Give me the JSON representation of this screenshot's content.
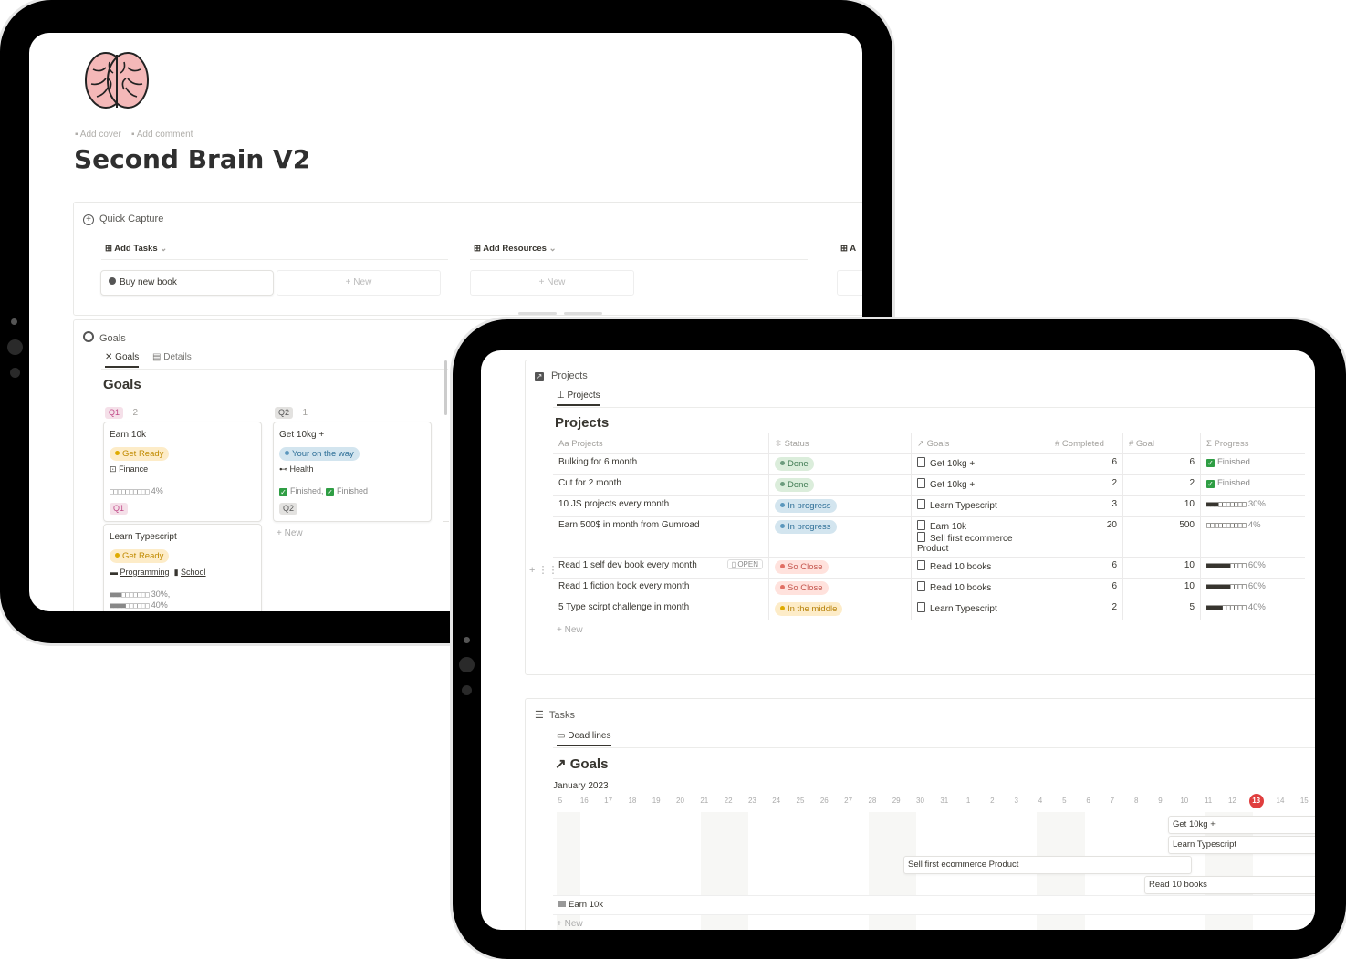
{
  "back": {
    "add_cover": "Add cover",
    "add_comment": "Add comment",
    "page_title": "Second Brain V2",
    "quick_capture": {
      "title": "Quick Capture",
      "add_tasks": "Add Tasks",
      "add_resources": "Add Resources",
      "clipped": "A",
      "task_item": "Buy new book",
      "new_label": "New"
    },
    "goals": {
      "section_title": "Goals",
      "tab_goals": "Goals",
      "tab_details": "Details",
      "heading": "Goals",
      "q1": {
        "label": "Q1",
        "count": "2"
      },
      "q2": {
        "label": "Q2",
        "count": "1"
      },
      "cards": {
        "earn": {
          "title": "Earn 10k",
          "status": "Get Ready",
          "tag": "Finance",
          "progress": "4%",
          "q": "Q1",
          "progress_value": 0.04
        },
        "typescript": {
          "title": "Learn Typescript",
          "status": "Get Ready",
          "tag1": "Programming",
          "tag2": "School",
          "p1": "30%",
          "p2": "40%",
          "p1_value": 0.3,
          "p2_value": 0.4
        },
        "get10kg": {
          "title": "Get 10kg +",
          "status": "Your on the way",
          "tag": "Health",
          "done1": "Finished",
          "done2": "Finished",
          "q": "Q2"
        }
      },
      "new_label": "New"
    }
  },
  "front": {
    "projects": {
      "section_title": "Projects",
      "tab": "Projects",
      "heading": "Projects",
      "columns": {
        "name": "Aa Projects",
        "status": "Status",
        "goals": "Goals",
        "completed": "# Completed",
        "goal": "# Goal",
        "progress": "Σ Progress"
      },
      "open_label": "OPEN",
      "rows": [
        {
          "name": "Bulking for 6 month",
          "status": "Done",
          "goals": [
            "Get 10kg +"
          ],
          "completed": "6",
          "goal": "6",
          "progress": "Finished",
          "progress_value": 1.0
        },
        {
          "name": "Cut for 2 month",
          "status": "Done",
          "goals": [
            "Get 10kg +"
          ],
          "completed": "2",
          "goal": "2",
          "progress": "Finished",
          "progress_value": 1.0
        },
        {
          "name": "10 JS projects every month",
          "status": "In progress",
          "goals": [
            "Learn Typescript"
          ],
          "completed": "3",
          "goal": "10",
          "progress": "30%",
          "progress_value": 0.3
        },
        {
          "name": "Earn 500$ in month from Gumroad",
          "status": "In progress",
          "goals": [
            "Earn 10k",
            "Sell first ecommerce Product"
          ],
          "completed": "20",
          "goal": "500",
          "progress": "4%",
          "progress_value": 0.04
        },
        {
          "name": "Read 1 self dev book every month",
          "status": "So Close",
          "goals": [
            "Read 10 books"
          ],
          "completed": "6",
          "goal": "10",
          "progress": "60%",
          "progress_value": 0.6
        },
        {
          "name": "Read 1 fiction book every month",
          "status": "So Close",
          "goals": [
            "Read 10 books"
          ],
          "completed": "6",
          "goal": "10",
          "progress": "60%",
          "progress_value": 0.6
        },
        {
          "name": "5 Type scirpt challenge in month",
          "status": "In the middle",
          "goals": [
            "Learn Typescript"
          ],
          "completed": "2",
          "goal": "5",
          "progress": "40%",
          "progress_value": 0.4
        }
      ],
      "new_label": "New"
    },
    "tasks": {
      "section_title": "Tasks",
      "tab": "Dead lines",
      "heading": "Goals",
      "month": "January 2023",
      "days": [
        "5",
        "16",
        "17",
        "18",
        "19",
        "20",
        "21",
        "22",
        "23",
        "24",
        "25",
        "26",
        "27",
        "28",
        "29",
        "30",
        "31",
        "1",
        "2",
        "3",
        "4",
        "5",
        "6",
        "7",
        "8",
        "9",
        "10",
        "11",
        "12",
        "13",
        "14",
        "15"
      ],
      "today": "13",
      "bars": {
        "get10kg": "Get 10kg +",
        "typescript": "Learn Typescript",
        "ecommerce": "Sell first ecommerce Product",
        "read": "Read 10 books",
        "earn": "Earn 10k"
      },
      "new_label": "New"
    }
  },
  "colors": {
    "done_bg": "#dbeddb",
    "done_dot": "#6c9b7d",
    "progress_bg": "#d3e5ef",
    "progress_dot": "#5b97bd",
    "close_bg": "#ffe2dd",
    "close_dot": "#e16f64",
    "middle_bg": "#fdecc8",
    "middle_dot": "#dfab01",
    "today": "#e03e3e"
  }
}
